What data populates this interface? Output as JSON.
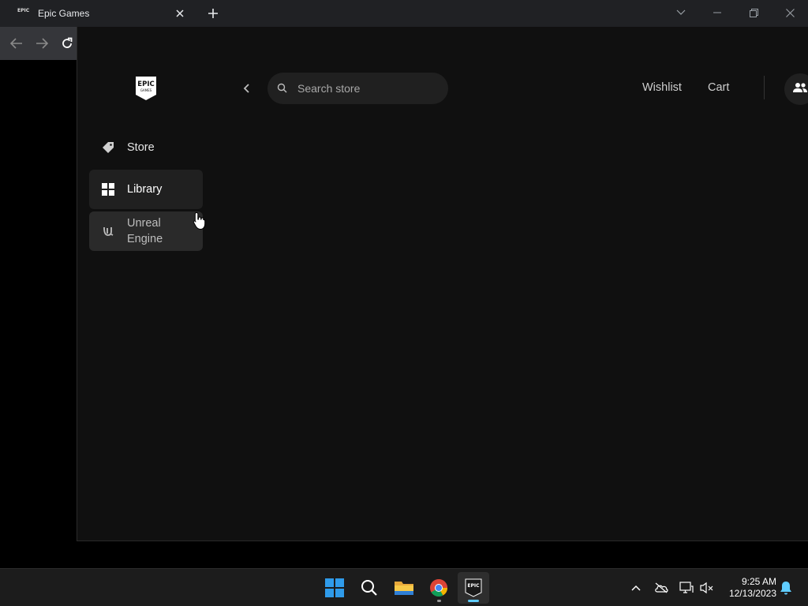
{
  "browser": {
    "tab_title": "Epic Games",
    "tab_favicon_text": "EPIC",
    "icons": [
      "epic-favicon",
      "close-icon",
      "plus-icon",
      "chevron-down-icon",
      "minimize-icon",
      "restore-icon",
      "close-window-icon",
      "back-arrow-icon",
      "forward-arrow-icon",
      "reload-icon"
    ]
  },
  "launcher": {
    "logo_text_top": "EPIC",
    "logo_text_bottom": "GAMES",
    "sidebar": {
      "items": [
        {
          "label": "Store",
          "icon": "tag-icon",
          "state": "default"
        },
        {
          "label": "Library",
          "icon": "grid-icon",
          "state": "selected"
        },
        {
          "label": "Unreal Engine",
          "icon": "unreal-icon",
          "state": "hover"
        }
      ]
    },
    "header": {
      "search_placeholder": "Search store",
      "wishlist_label": "Wishlist",
      "cart_label": "Cart",
      "friends_icon": "friends-icon",
      "back_icon": "chevron-left-icon"
    }
  },
  "taskbar": {
    "apps": [
      "windows-start-icon",
      "search-icon",
      "file-explorer-icon",
      "chrome-icon",
      "epic-games-icon"
    ],
    "epic_icon_text": "EPIC",
    "tray": [
      "chevron-up-icon",
      "onedrive-icon",
      "network-icon",
      "volume-muted-icon",
      "notification-bell-icon"
    ],
    "time": "9:25 AM",
    "date": "12/13/2023"
  },
  "colors": {
    "launcher_bg": "#101010",
    "selected_item_bg": "#202020",
    "hover_item_bg": "#2a2a2a",
    "accent": "#60cdff"
  }
}
